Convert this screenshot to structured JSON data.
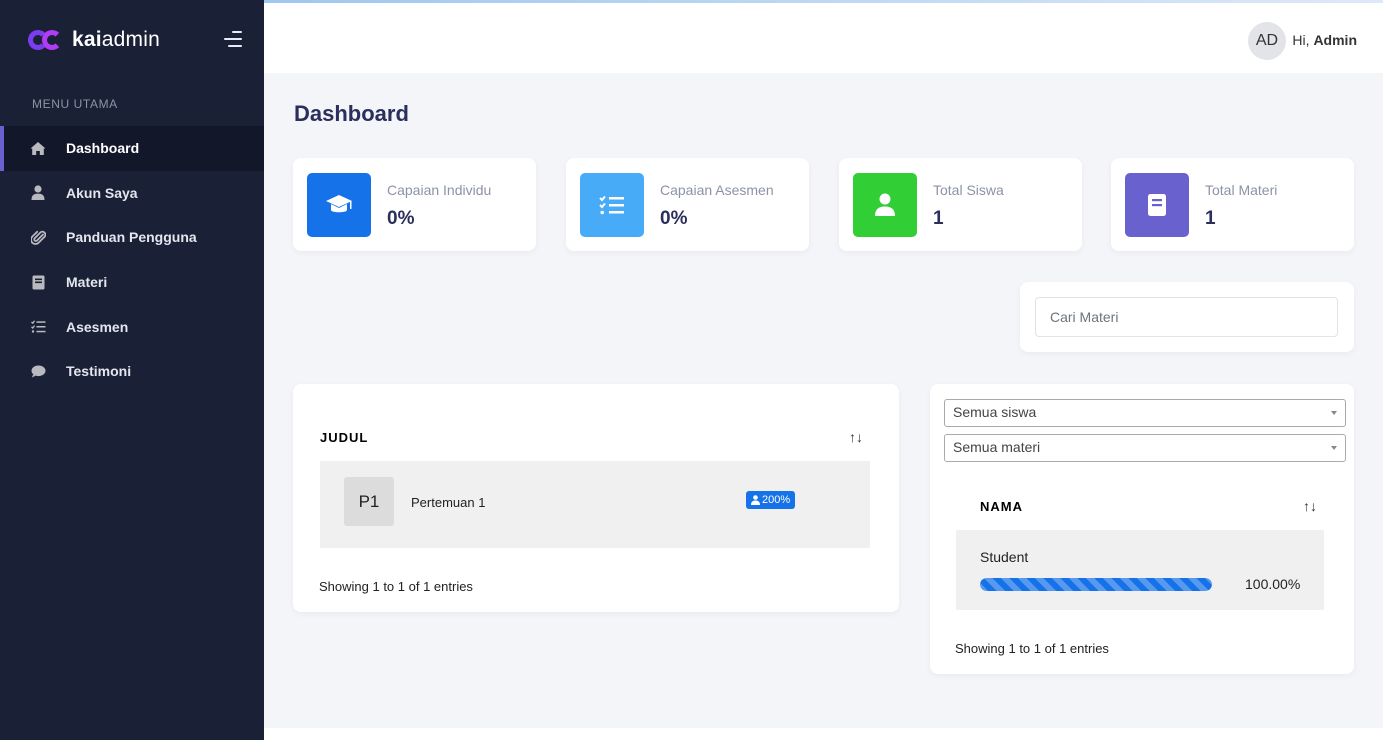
{
  "brand": {
    "bold": "kai",
    "light": "admin"
  },
  "sidebar": {
    "caption": "MENU UTAMA",
    "items": [
      {
        "label": "Dashboard",
        "icon": "home-icon",
        "active": true
      },
      {
        "label": "Akun Saya",
        "icon": "user-icon"
      },
      {
        "label": "Panduan Pengguna",
        "icon": "paperclip-icon"
      },
      {
        "label": "Materi",
        "icon": "book-icon"
      },
      {
        "label": "Asesmen",
        "icon": "checklist-icon"
      },
      {
        "label": "Testimoni",
        "icon": "comment-icon"
      }
    ]
  },
  "topbar": {
    "avatar_initials": "AD",
    "greeting": "Hi,",
    "username": "Admin"
  },
  "page_title": "Dashboard",
  "stats": [
    {
      "label": "Capaian Individu",
      "value": "0%",
      "icon": "graduation-cap-icon",
      "color": "#1572e8"
    },
    {
      "label": "Capaian Asesmen",
      "value": "0%",
      "icon": "checklist-icon",
      "color": "#48abf7"
    },
    {
      "label": "Total Siswa",
      "value": "1",
      "icon": "user-icon",
      "color": "#31ce36"
    },
    {
      "label": "Total Materi",
      "value": "1",
      "icon": "book-icon",
      "color": "#6861ce"
    }
  ],
  "search": {
    "placeholder": "Cari Materi"
  },
  "materi_table": {
    "header": "JUDUL",
    "rows": [
      {
        "code": "P1",
        "title": "Pertemuan 1",
        "badge": "200%"
      }
    ],
    "footer": "Showing 1 to 1 of 1 entries"
  },
  "student_table": {
    "filter_student": "Semua siswa",
    "filter_materi": "Semua materi",
    "header": "NAMA",
    "rows": [
      {
        "name": "Student",
        "progress": 1.0,
        "percent_label": "100.00%"
      }
    ],
    "footer": "Showing 1 to 1 of 1 entries"
  },
  "colors": {
    "sidebar": "#1a2035",
    "active_accent": "#6861ce",
    "primary": "#1572e8"
  }
}
